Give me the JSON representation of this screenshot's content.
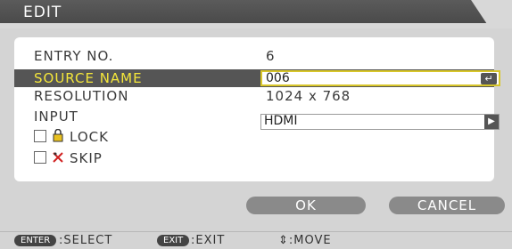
{
  "window": {
    "title": "EDIT"
  },
  "fields": {
    "entry_no": {
      "label": "ENTRY NO.",
      "value": "6"
    },
    "source_name": {
      "label": "SOURCE NAME",
      "value": "006"
    },
    "resolution": {
      "label": "RESOLUTION",
      "value": "1024 x 768"
    },
    "input": {
      "label": "INPUT",
      "value": "HDMI"
    }
  },
  "options": {
    "lock": {
      "label": "LOCK",
      "checked": false,
      "icon": "lock-icon"
    },
    "skip": {
      "label": "SKIP",
      "checked": false,
      "icon": "skip-icon"
    }
  },
  "buttons": {
    "ok": "OK",
    "cancel": "CANCEL"
  },
  "footer": {
    "enter_key": "ENTER",
    "enter_hint": ":SELECT",
    "exit_key": "EXIT",
    "exit_hint": ":EXIT",
    "move_hint": "⇕:MOVE"
  },
  "colors": {
    "accent_yellow": "#f4e63a",
    "selection_bg": "#555555",
    "panel_bg": "#d4d4d4"
  }
}
